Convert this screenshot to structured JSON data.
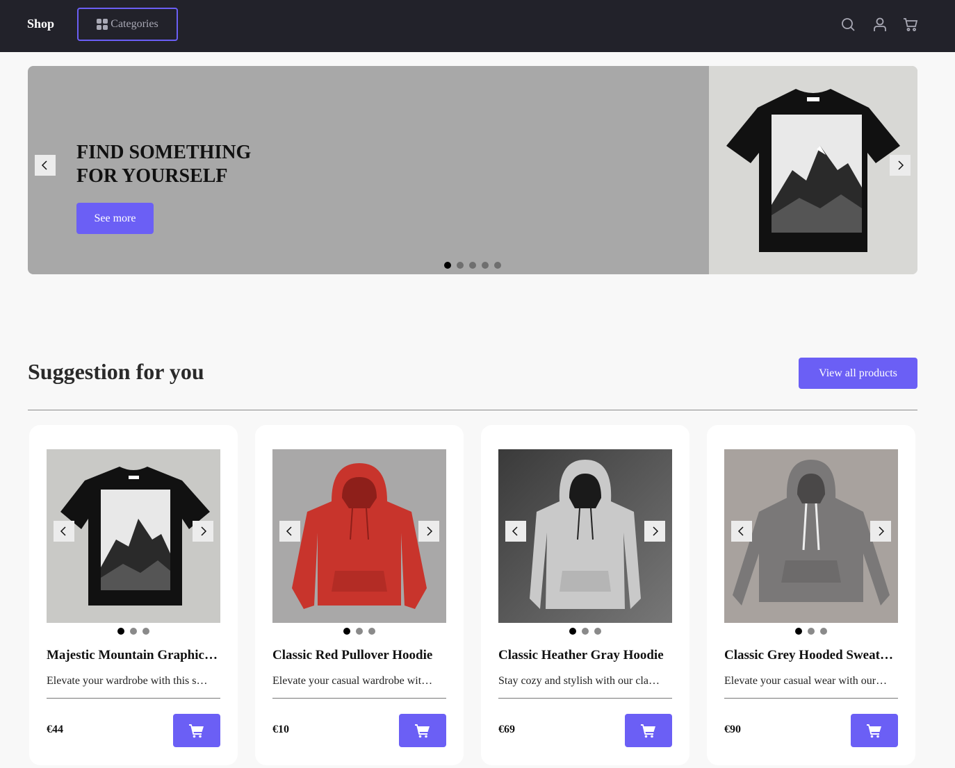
{
  "header": {
    "brand": "Shop",
    "categories_label": "Categories",
    "icons": [
      "search-icon",
      "user-icon",
      "cart-icon"
    ]
  },
  "hero": {
    "title": "FIND SOMETHING\nFOR YOURSELF",
    "cta_label": "See more",
    "slide_count": 5,
    "active_slide": 1,
    "image": "black mountain graphic t-shirt"
  },
  "suggestions": {
    "title": "Suggestion for you",
    "view_all_label": "View all products",
    "products": [
      {
        "title": "Majestic Mountain Graphic Tee",
        "description": "Elevate your wardrobe with this stylish black t-shirt",
        "price": "€44",
        "image": "black mountain graphic t-shirt",
        "image_count": 3,
        "active_image": 1
      },
      {
        "title": "Classic Red Pullover Hoodie",
        "description": "Elevate your casual wardrobe with our classic red pullover",
        "price": "€10",
        "image": "red pullover hoodie",
        "image_count": 3,
        "active_image": 1
      },
      {
        "title": "Classic Heather Gray Hoodie",
        "description": "Stay cozy and stylish with our classic heather gray hoodie",
        "price": "€69",
        "image": "heather gray hoodie",
        "image_count": 3,
        "active_image": 1
      },
      {
        "title": "Classic Grey Hooded Sweatshirt",
        "description": "Elevate your casual wear with our classic grey hooded sweatshirt",
        "price": "€90",
        "image": "grey hooded sweatshirt",
        "image_count": 3,
        "active_image": 1
      }
    ]
  },
  "colors": {
    "accent": "#6b5ff5",
    "topbar": "#22222a",
    "page_bg": "#f8f8f8",
    "hero_bg": "#a8a8a8"
  }
}
